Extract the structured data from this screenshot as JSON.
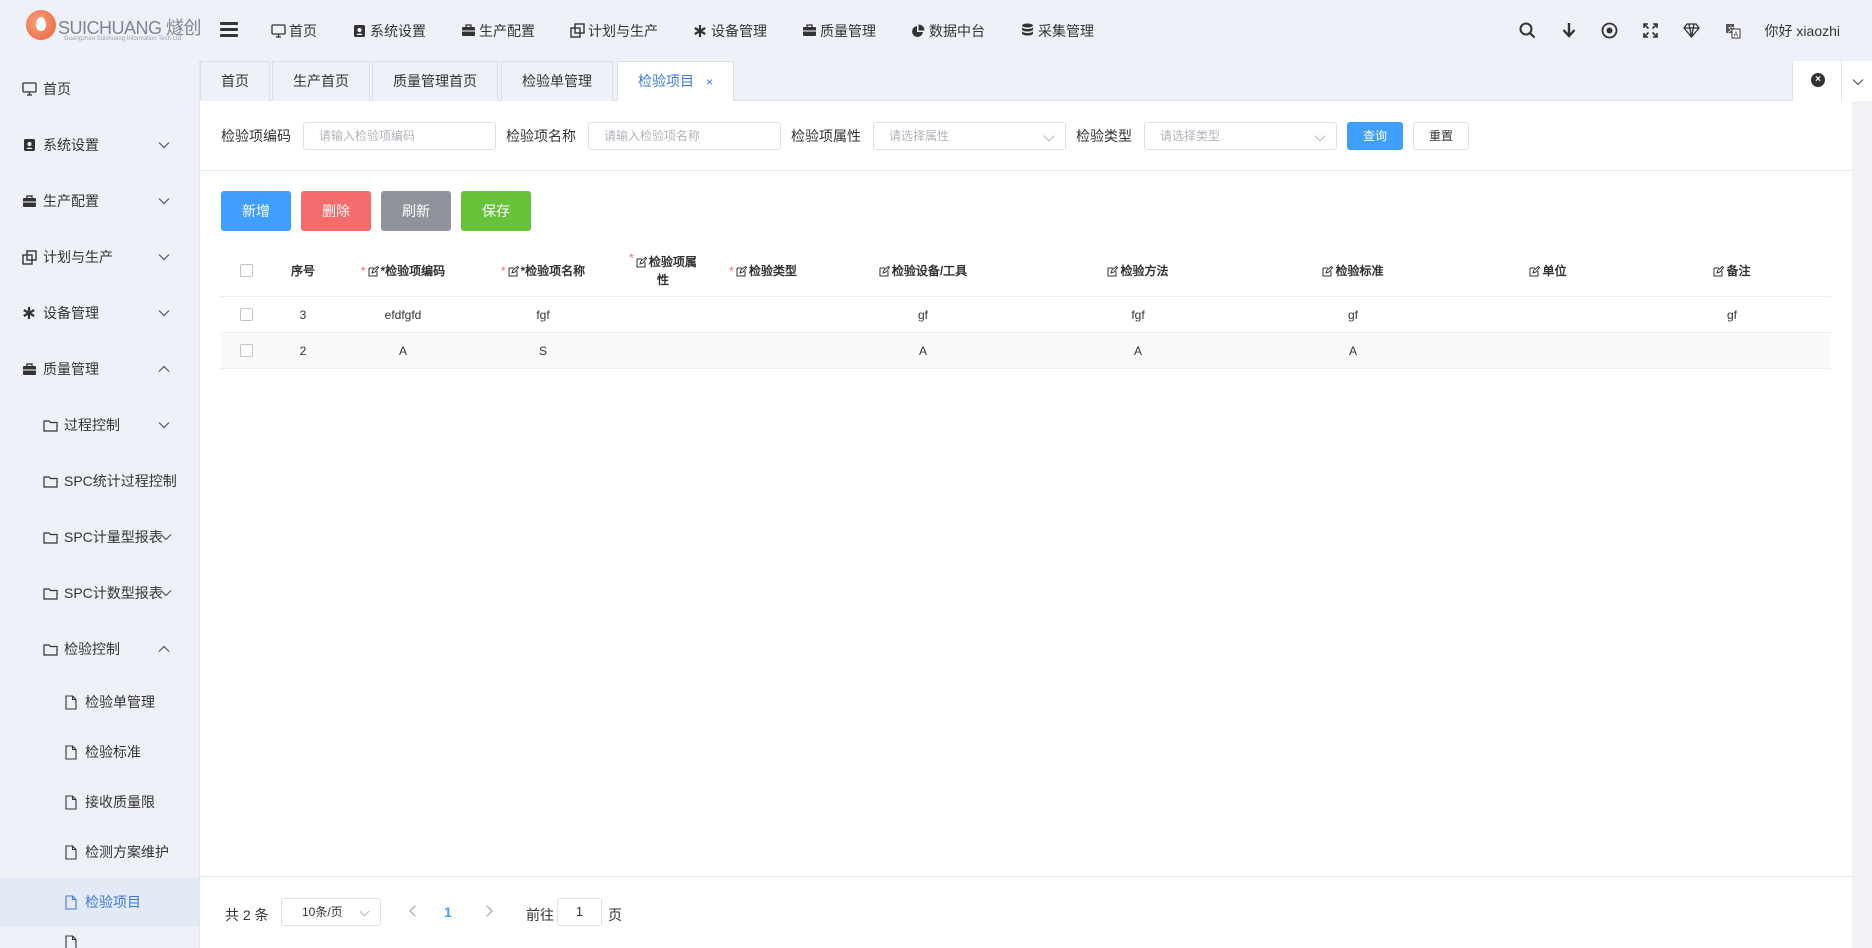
{
  "header": {
    "brand": "SUICHUANG 燧创",
    "brand_sub": "Guangzhou Suichuang Information Tech Ltd",
    "nav": [
      {
        "label": "首页",
        "icon": "monitor-icon"
      },
      {
        "label": "系统设置",
        "icon": "user-badge-icon"
      },
      {
        "label": "生产配置",
        "icon": "briefcase-icon"
      },
      {
        "label": "计划与生产",
        "icon": "clone-icon"
      },
      {
        "label": "设备管理",
        "icon": "asterisk-icon"
      },
      {
        "label": "质量管理",
        "icon": "briefcase-icon"
      },
      {
        "label": "数据中台",
        "icon": "pie-chart-icon"
      },
      {
        "label": "采集管理",
        "icon": "database-icon"
      }
    ],
    "user_greeting": "你好 xiaozhi"
  },
  "sidebar": {
    "items": [
      {
        "label": "首页",
        "icon": "monitor-icon"
      },
      {
        "label": "系统设置",
        "icon": "user-badge-icon"
      },
      {
        "label": "生产配置",
        "icon": "briefcase-icon"
      },
      {
        "label": "计划与生产",
        "icon": "clone-icon"
      },
      {
        "label": "设备管理",
        "icon": "asterisk-icon"
      },
      {
        "label": "质量管理",
        "icon": "briefcase-icon"
      },
      {
        "label": "过程控制",
        "icon": "folder-icon"
      },
      {
        "label": "SPC统计过程控制",
        "icon": "folder-icon"
      },
      {
        "label": "SPC计量型报表",
        "icon": "folder-icon"
      },
      {
        "label": "SPC计数型报表",
        "icon": "folder-icon"
      },
      {
        "label": "检验控制",
        "icon": "folder-icon"
      },
      {
        "label": "检验单管理",
        "icon": "document-icon"
      },
      {
        "label": "检验标准",
        "icon": "document-icon"
      },
      {
        "label": "接收质量限",
        "icon": "document-icon"
      },
      {
        "label": "检测方案维护",
        "icon": "document-icon"
      },
      {
        "label": "检验项目",
        "icon": "document-icon"
      }
    ]
  },
  "tabs": [
    {
      "label": "首页"
    },
    {
      "label": "生产首页"
    },
    {
      "label": "质量管理首页"
    },
    {
      "label": "检验单管理"
    },
    {
      "label": "检验项目",
      "close": "×"
    }
  ],
  "search": {
    "code_label": "检验项编码",
    "code_placeholder": "请输入检验项编码",
    "name_label": "检验项名称",
    "name_placeholder": "请输入检验项名称",
    "attr_label": "检验项属性",
    "attr_placeholder": "请选择属性",
    "type_label": "检验类型",
    "type_placeholder": "请选择类型",
    "query": "查询",
    "reset": "重置"
  },
  "actions": {
    "add": "新增",
    "delete": "删除",
    "refresh": "刷新",
    "save": "保存"
  },
  "table": {
    "headers": {
      "index": "序号",
      "code": "*检验项编码",
      "name": "*检验项名称",
      "attr": "检验项属",
      "attr2": "性",
      "type": "检验类型",
      "device": "检验设备/工具",
      "method": "检验方法",
      "standard": "检验标准",
      "unit": "单位",
      "remark": "备注"
    },
    "rows": [
      {
        "index": "3",
        "code": "efdfgfd",
        "name": "fgf",
        "attr": "",
        "type": "",
        "device": "gf",
        "method": "fgf",
        "standard": "gf",
        "unit": "",
        "remark": "gf"
      },
      {
        "index": "2",
        "code": "A",
        "name": "S",
        "attr": "",
        "type": "",
        "device": "A",
        "method": "A",
        "standard": "A",
        "unit": "",
        "remark": ""
      }
    ]
  },
  "pagination": {
    "total": "共 2 条",
    "page_size": "10条/页",
    "current_page": "1",
    "goto_label": "前往",
    "goto_value": "1",
    "goto_unit": "页"
  },
  "colors": {
    "primary": "#409eff",
    "danger": "#f56c6c",
    "info": "#909399",
    "success": "#67c23a",
    "active_text": "#3a7be0"
  }
}
